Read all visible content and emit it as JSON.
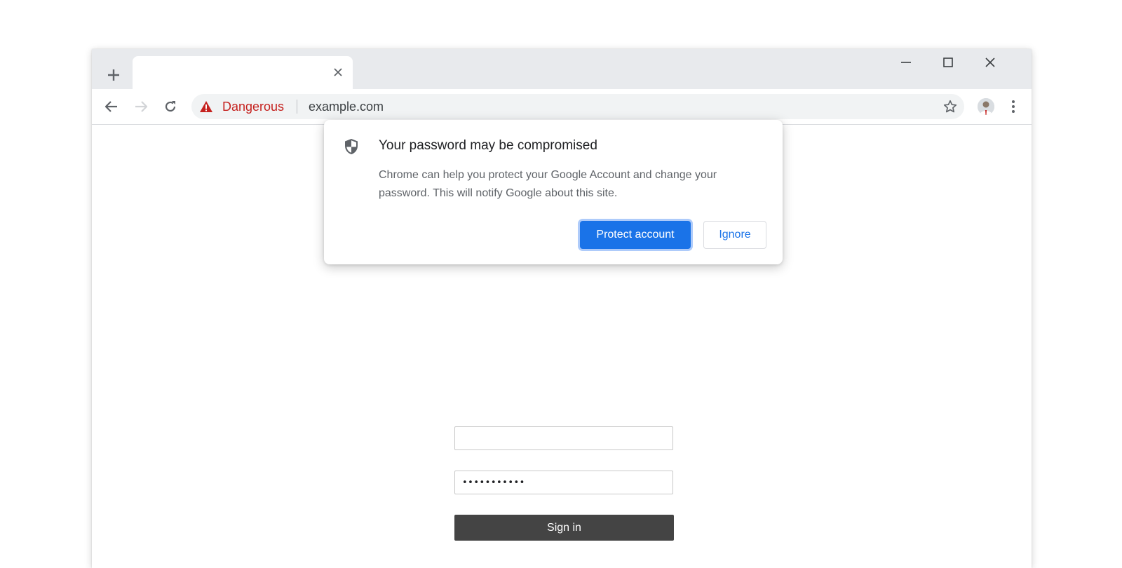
{
  "browser": {
    "tab": {
      "title": ""
    },
    "omnibox": {
      "security_label": "Dangerous",
      "url": "example.com"
    }
  },
  "bubble": {
    "title": "Your password may be compromised",
    "body": "Chrome can help you protect your Google Account and change your password. This will notify Google about this site.",
    "primary_label": "Protect account",
    "secondary_label": "Ignore"
  },
  "form": {
    "username_value": "",
    "password_value": "•••••••••••",
    "signin_label": "Sign in"
  },
  "icons": [
    "plus-icon",
    "close-icon",
    "minimize-icon",
    "maximize-icon",
    "back-arrow-icon",
    "forward-arrow-icon",
    "reload-icon",
    "warning-triangle-icon",
    "star-icon",
    "avatar-icon",
    "kebab-menu-icon",
    "shield-icon"
  ],
  "colors": {
    "danger": "#c5221f",
    "accent": "#1a73e8",
    "tabstrip": "#e8eaed",
    "signin": "#444444"
  }
}
